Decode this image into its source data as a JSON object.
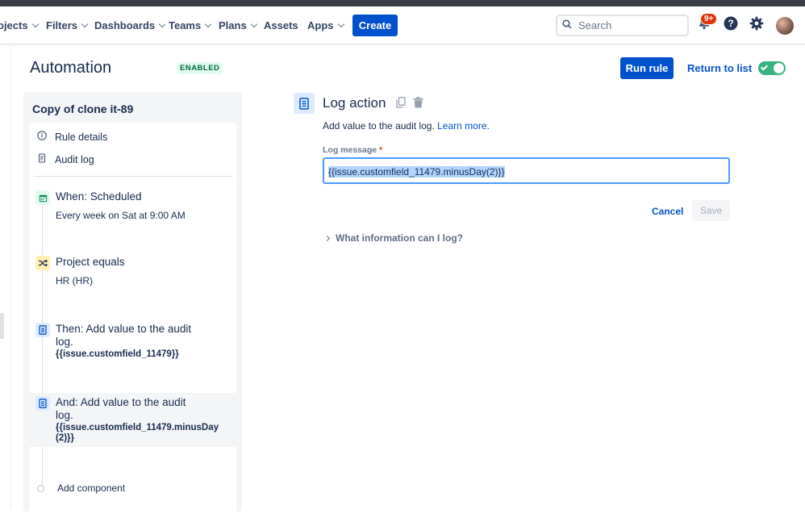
{
  "nav": {
    "items": [
      {
        "label": "ojects"
      },
      {
        "label": "Filters"
      },
      {
        "label": "Dashboards"
      },
      {
        "label": "Teams"
      },
      {
        "label": "Plans"
      },
      {
        "label": "Assets"
      },
      {
        "label": "Apps"
      }
    ],
    "create_label": "Create",
    "search_placeholder": "Search",
    "notification_badge": "9+"
  },
  "header": {
    "title": "Automation",
    "status": "ENABLED",
    "run_label": "Run rule",
    "return_label": "Return to list",
    "toggle_on": true
  },
  "rule": {
    "name": "Copy of clone it-89",
    "links": [
      {
        "label": "Rule details"
      },
      {
        "label": "Audit log"
      }
    ],
    "steps": [
      {
        "title": "When: Scheduled",
        "sub": "Every week on Sat at 9:00 AM"
      },
      {
        "title": "Project equals",
        "sub": "HR (HR)"
      },
      {
        "title": "Then: Add value to the audit log.",
        "sub": "{{issue.customfield_11479}}"
      },
      {
        "title": "And: Add value to the audit log.",
        "sub": "{{issue.customfield_11479.minusDay(2)}}"
      }
    ],
    "add_component": "Add component"
  },
  "action": {
    "title": "Log action",
    "desc": "Add value to the audit log.",
    "learn_more": "Learn more.",
    "field_label": "Log message",
    "required_mark": "*",
    "field_value": "{{issue.customfield_11479.minusDay(2)}}",
    "cancel_label": "Cancel",
    "save_label": "Save",
    "expander_label": "What information can I log?"
  },
  "colors": {
    "brand": "#0052cc",
    "enabled_bg": "#e3fcef",
    "toggle": "#36b37e",
    "badge": "#de350b"
  }
}
